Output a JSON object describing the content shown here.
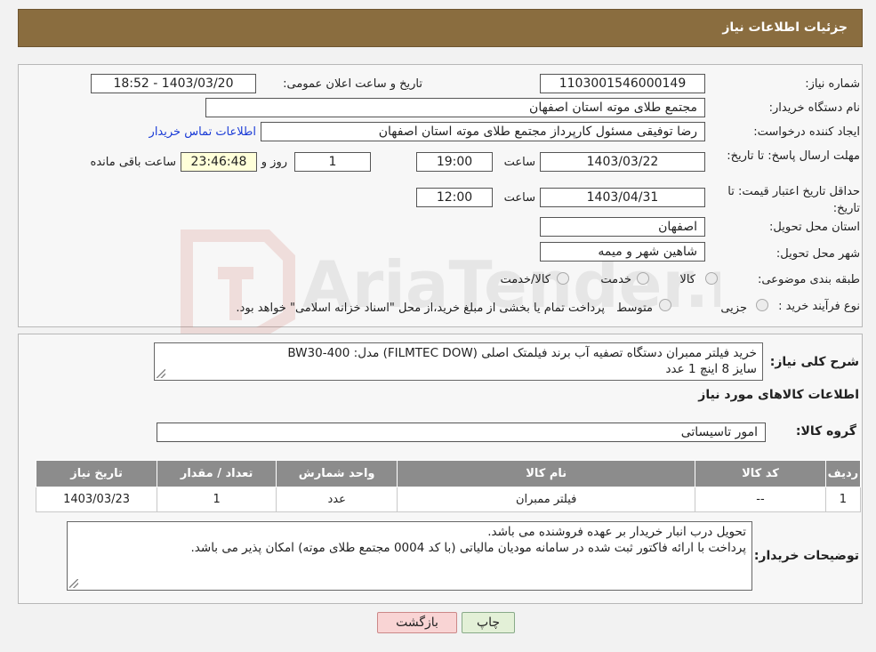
{
  "header": {
    "title": "جزئیات اطلاعات نیاز"
  },
  "watermark": {
    "text": "AriaTender.net"
  },
  "form": {
    "need_number_label": "شماره نیاز:",
    "need_number": "1103001546000149",
    "announce_label": "تاریخ و ساعت اعلان عمومی:",
    "announce_value": "1403/03/20 - 18:52",
    "buyer_org_label": "نام دستگاه خریدار:",
    "buyer_org": "مجتمع طلای موته استان اصفهان",
    "creator_label": "ایجاد کننده درخواست:",
    "creator": "رضا توفیقی مسئول کارپرداز مجتمع طلای موته استان اصفهان",
    "contact_link": "اطلاعات تماس خریدار",
    "reply_deadline_label": "مهلت ارسال پاسخ: تا تاریخ:",
    "reply_date": "1403/03/22",
    "time_label": "ساعت",
    "reply_time": "19:00",
    "days_count": "1",
    "days_label": "روز و",
    "remaining_time": "23:46:48",
    "remaining_label": "ساعت باقی مانده",
    "price_validity_label": "حداقل تاریخ اعتبار قیمت: تا تاریخ:",
    "price_date": "1403/04/31",
    "price_time": "12:00",
    "province_label": "استان محل تحویل:",
    "province": "اصفهان",
    "city_label": "شهر محل تحویل:",
    "city": "شاهین شهر و میمه",
    "category_label": "طبقه بندی موضوعی:",
    "category_options": [
      "کالا",
      "خدمت",
      "کالا/خدمت"
    ],
    "process_label": "نوع فرآیند خرید :",
    "process_options": [
      "جزیی",
      "متوسط"
    ],
    "process_note": "پرداخت تمام یا بخشی از مبلغ خرید،از محل \"اسناد خزانه اسلامی\" خواهد بود."
  },
  "details": {
    "summary_label": "شرح کلی نیاز:",
    "summary_line1": "خرید فیلتر ممبران دستگاه تصفیه آب برند فیلمتک اصلی (FILMTEC DOW) مدل: BW30-400",
    "summary_line2": "سایز 8 اینچ 1 عدد",
    "items_heading": "اطلاعات کالاهای مورد نیاز",
    "group_label": "گروه کالا:",
    "group_value": "امور تاسیساتی"
  },
  "table": {
    "headers": [
      "ردیف",
      "کد کالا",
      "نام کالا",
      "واحد شمارش",
      "تعداد / مقدار",
      "تاریخ نیاز"
    ],
    "rows": [
      [
        "1",
        "--",
        "فیلتر ممبران",
        "عدد",
        "1",
        "1403/03/23"
      ]
    ]
  },
  "buyer_notes": {
    "label": "توضیحات خریدار:",
    "line1": "تحویل درب انبار خریدار بر عهده فروشنده می باشد.",
    "line2": "پرداخت با ارائه فاکتور ثبت شده در سامانه مودیان مالیاتی (با کد 0004 مجتمع طلای موته) امکان پذیر می باشد."
  },
  "buttons": {
    "print": "چاپ",
    "back": "بازگشت"
  },
  "colors": {
    "header_bg": "#8a6d3f",
    "table_header_bg": "#8c8c8c",
    "remaining_bg": "#ffffd9",
    "back_btn_bg": "#f9d4d4",
    "print_btn_bg": "#e3f0d7"
  }
}
